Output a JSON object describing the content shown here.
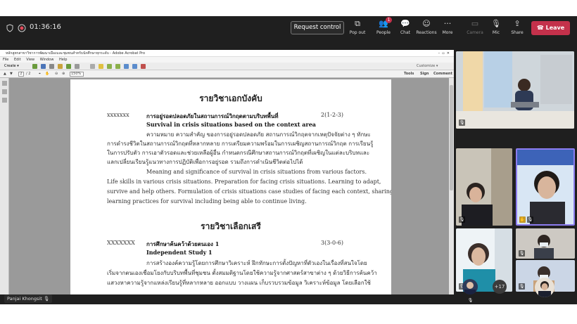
{
  "meeting": {
    "timer": "01:36:16",
    "request_control_label": "Request control",
    "toolbar": [
      {
        "label": "Pop out",
        "icon": "pop-out-icon"
      },
      {
        "label": "People",
        "icon": "people-icon",
        "badge": "1"
      },
      {
        "label": "Chat",
        "icon": "chat-icon"
      },
      {
        "label": "Reactions",
        "icon": "reactions-icon"
      },
      {
        "label": "More",
        "icon": "more-icon"
      },
      {
        "label": "Camera",
        "icon": "camera-off-icon"
      },
      {
        "label": "Mic",
        "icon": "mic-off-icon"
      },
      {
        "label": "Share",
        "icon": "share-icon"
      }
    ],
    "leave_label": "Leave",
    "presenter_name": "Panjai Khongsit",
    "overflow_count": "+17",
    "leave_color": "#c4314b",
    "active_speaker_color": "#8c7cf0"
  },
  "acrobat": {
    "title": "หลักสูตรสาขาวิชาการพัฒนาเมืองและชุมชนสำหรับนักศึกษาทุกระดับ - Adobe Acrobat Pro",
    "menu": [
      "File",
      "Edit",
      "View",
      "Window",
      "Help"
    ],
    "create_label": "Create",
    "customize_label": "Customize",
    "page_current": "2",
    "page_total": "/ 2",
    "zoom": "150%",
    "right_tabs": [
      "Tools",
      "Sign",
      "Comment"
    ]
  },
  "pdf": {
    "heading1": "รายวิชาเอกบังคับ",
    "course1_code": "xxxxxxx",
    "course1_title_th": "การอยู่รอดปลอดภัยในสถานการณ์วิกฤตตามบริบทพื้นที่",
    "course1_credits": "2(1-2-3)",
    "course1_title_en": "Survival in crisis situations based on the context area",
    "course1_desc_th": [
      "ความหมาย ความสำคัญ ของการอยู่รอดปลอดภัย สถานการณ์วิกฤตจากเหตุปัจจัยต่าง ๆ ทักษะ",
      "การดำรงชีวิตในสถานการณ์วิกฤตที่หลากหลาย การเตรียมความพร้อมในการเผชิญสถานการณ์วิกฤต การเรียนรู้",
      "ในการปรับตัว การเอาตัวรอดและช่วยเหลือผู้อื่น กำหนดกรณีศึกษาสถานการณ์วิกฤตที่เผชิญในแต่ละบริบทและ",
      "แลกเปลี่ยนเรียนรู้แนวทางการปฏิบัติเพื่อการอยู่รอด รวมถึงการดำเนินชีวิตต่อไปได้"
    ],
    "course1_desc_en": [
      "Meaning and significance of survival in crisis situations from various factors.",
      "Life skills in various crisis situations. Preparation for facing crisis situations. Learning to adapt,",
      "survive and help others. Formulation of crisis situations case studies of facing each context, sharing",
      "learning practices for survival including being able to continue living."
    ],
    "heading2": "รายวิชาเลือกเสรี",
    "course2_code": "XXXXXXX",
    "course2_title_th": "การศึกษาค้นคว้าด้วยตนเอง 1",
    "course2_credits": "3(3-0-6)",
    "course2_title_en": "Independent Study 1",
    "course2_desc_th": [
      "การสร้างองค์ความรู้โดยการศึกษาวิเคราะห์ ฝึกทักษะการตั้งปัญหาที่ตัวเองในเรื่องที่สนใจโดย",
      "เริ่มจากตนเองเชื่อมโยงกับบริบทพื้นที่ชุมชน ตั้งสมมติฐานโดยใช้ความรู้จากศาสตร์สาขาต่าง ๆ ด้วยวิธีการค้นคว้า",
      "แสวงหาความรู้จากแหล่งเรียนรู้ที่หลากหลาย ออกแบบ วางแผน เก็บรวบรวมข้อมูล วิเคราะห์ข้อมูล โดยเลือกใช้"
    ]
  }
}
